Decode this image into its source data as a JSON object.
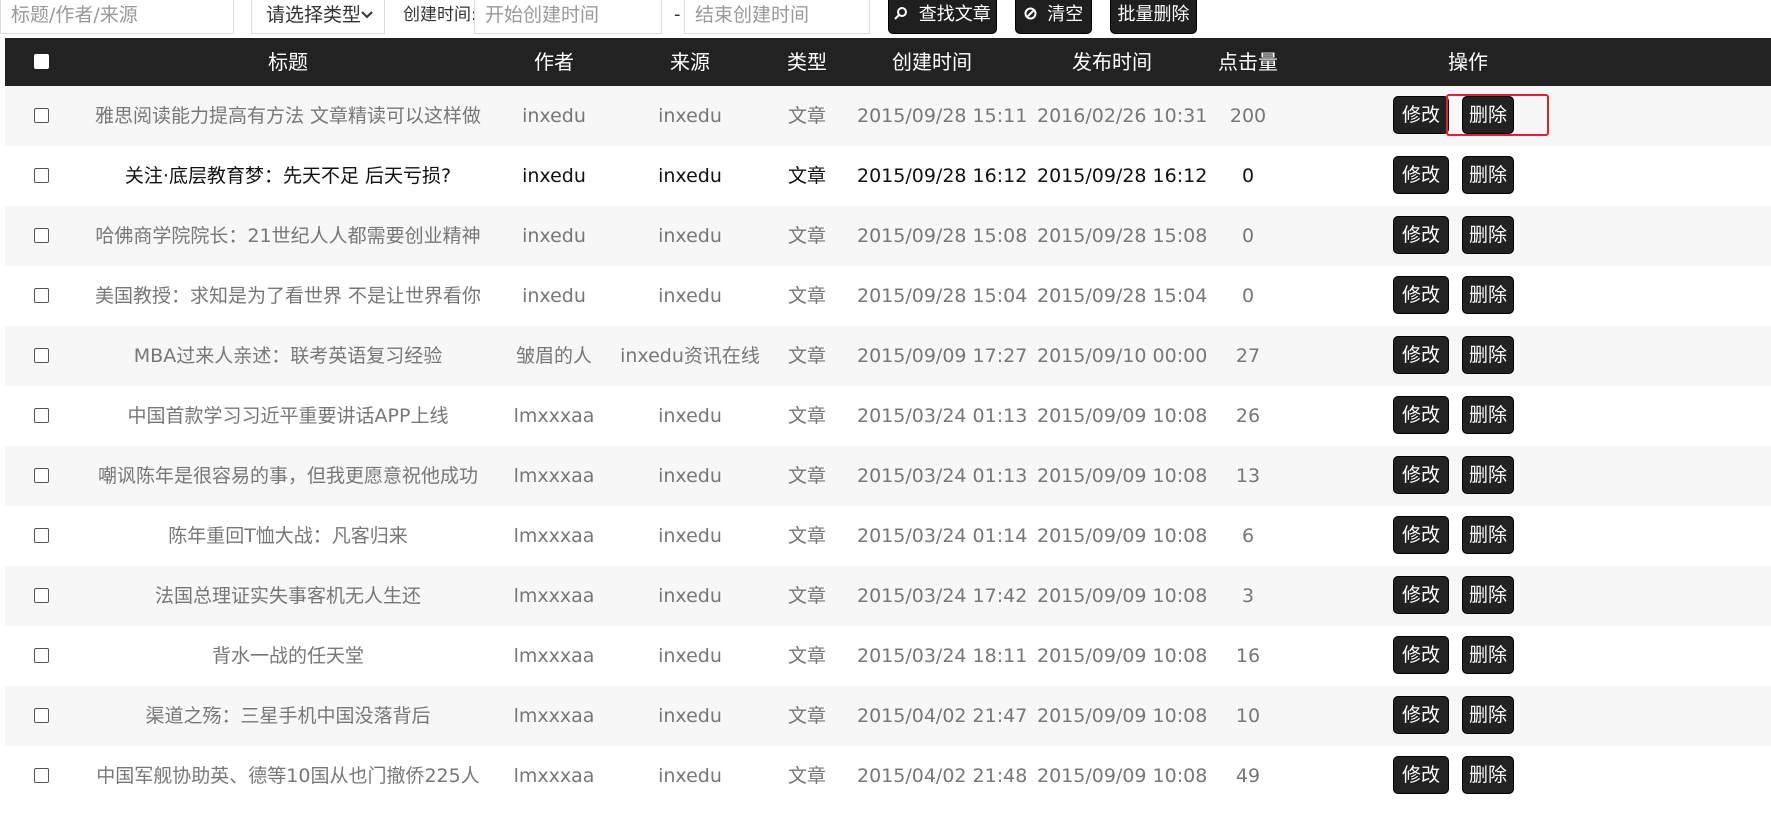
{
  "toolbar": {
    "search_placeholder": "标题/作者/来源",
    "type_select_value": "请选择类型",
    "created_label": "创建时间:",
    "start_placeholder": "开始创建时间",
    "dash": "-",
    "end_placeholder": "结束创建时间",
    "search_button": "查找文章",
    "clear_button": "清空",
    "batch_delete_button": "批量删除"
  },
  "table": {
    "headers": {
      "title": "标题",
      "author": "作者",
      "source": "来源",
      "type": "类型",
      "created": "创建时间",
      "published": "发布时间",
      "clicks": "点击量",
      "actions": "操作"
    },
    "edit_label": "修改",
    "delete_label": "删除",
    "rows": [
      {
        "title": "雅思阅读能力提高有方法 文章精读可以这样做",
        "author": "inxedu",
        "source": "inxedu",
        "type": "文章",
        "created": "2015/09/28 15:11",
        "published": "2016/02/26 10:31",
        "clicks": "200"
      },
      {
        "title": "关注·底层教育梦：先天不足 后天亏损?",
        "author": "inxedu",
        "source": "inxedu",
        "type": "文章",
        "created": "2015/09/28 16:12",
        "published": "2015/09/28 16:12",
        "clicks": "0"
      },
      {
        "title": "哈佛商学院院长：21世纪人人都需要创业精神",
        "author": "inxedu",
        "source": "inxedu",
        "type": "文章",
        "created": "2015/09/28 15:08",
        "published": "2015/09/28 15:08",
        "clicks": "0"
      },
      {
        "title": "美国教授：求知是为了看世界 不是让世界看你",
        "author": "inxedu",
        "source": "inxedu",
        "type": "文章",
        "created": "2015/09/28 15:04",
        "published": "2015/09/28 15:04",
        "clicks": "0"
      },
      {
        "title": "MBA过来人亲述：联考英语复习经验",
        "author": "皱眉的人",
        "source": "inxedu资讯在线",
        "type": "文章",
        "created": "2015/09/09 17:27",
        "published": "2015/09/10 00:00",
        "clicks": "27"
      },
      {
        "title": "中国首款学习习近平重要讲话APP上线",
        "author": "lmxxxaa",
        "source": "inxedu",
        "type": "文章",
        "created": "2015/03/24 01:13",
        "published": "2015/09/09 10:08",
        "clicks": "26"
      },
      {
        "title": "嘲讽陈年是很容易的事，但我更愿意祝他成功",
        "author": "lmxxxaa",
        "source": "inxedu",
        "type": "文章",
        "created": "2015/03/24 01:13",
        "published": "2015/09/09 10:08",
        "clicks": "13"
      },
      {
        "title": "陈年重回T恤大战：凡客归来",
        "author": "lmxxxaa",
        "source": "inxedu",
        "type": "文章",
        "created": "2015/03/24 01:14",
        "published": "2015/09/09 10:08",
        "clicks": "6"
      },
      {
        "title": "法国总理证实失事客机无人生还",
        "author": "lmxxxaa",
        "source": "inxedu",
        "type": "文章",
        "created": "2015/03/24 17:42",
        "published": "2015/09/09 10:08",
        "clicks": "3"
      },
      {
        "title": "背水一战的任天堂",
        "author": "lmxxxaa",
        "source": "inxedu",
        "type": "文章",
        "created": "2015/03/24 18:11",
        "published": "2015/09/09 10:08",
        "clicks": "16"
      },
      {
        "title": "渠道之殇：三星手机中国没落背后",
        "author": "lmxxxaa",
        "source": "inxedu",
        "type": "文章",
        "created": "2015/04/02 21:47",
        "published": "2015/09/09 10:08",
        "clicks": "10"
      },
      {
        "title": "中国军舰协助英、德等10国从也门撤侨225人",
        "author": "lmxxxaa",
        "source": "inxedu",
        "type": "文章",
        "created": "2015/04/02 21:48",
        "published": "2015/09/09 10:08",
        "clicks": "49"
      }
    ]
  },
  "colors": {
    "header_bg": "#222222",
    "highlight": "#e0252a"
  }
}
